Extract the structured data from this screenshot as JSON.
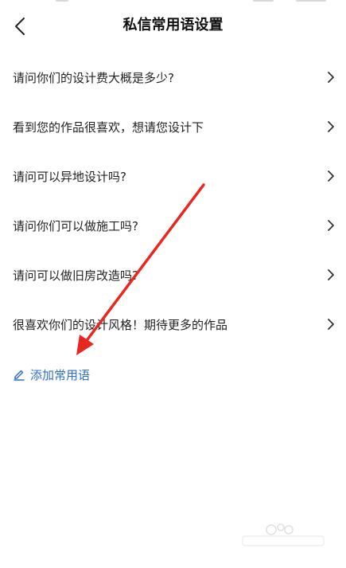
{
  "header": {
    "title": "私信常用语设置"
  },
  "phrases": [
    {
      "text": "请问你们的设计费大概是多少?"
    },
    {
      "text": "看到您的作品很喜欢，想请您设计下"
    },
    {
      "text": "请问可以异地设计吗?"
    },
    {
      "text": "请问你们可以做施工吗?"
    },
    {
      "text": "请问可以做旧房改造吗?"
    },
    {
      "text": "很喜欢你们的设计风格！期待更多的作品"
    }
  ],
  "add_action": {
    "label": "添加常用语"
  },
  "colors": {
    "accent": "#2f6fcf",
    "annotation": "#e8271f",
    "text": "#222222"
  },
  "icons": [
    "back-arrow-icon",
    "chevron-right-icon",
    "pen-icon"
  ]
}
